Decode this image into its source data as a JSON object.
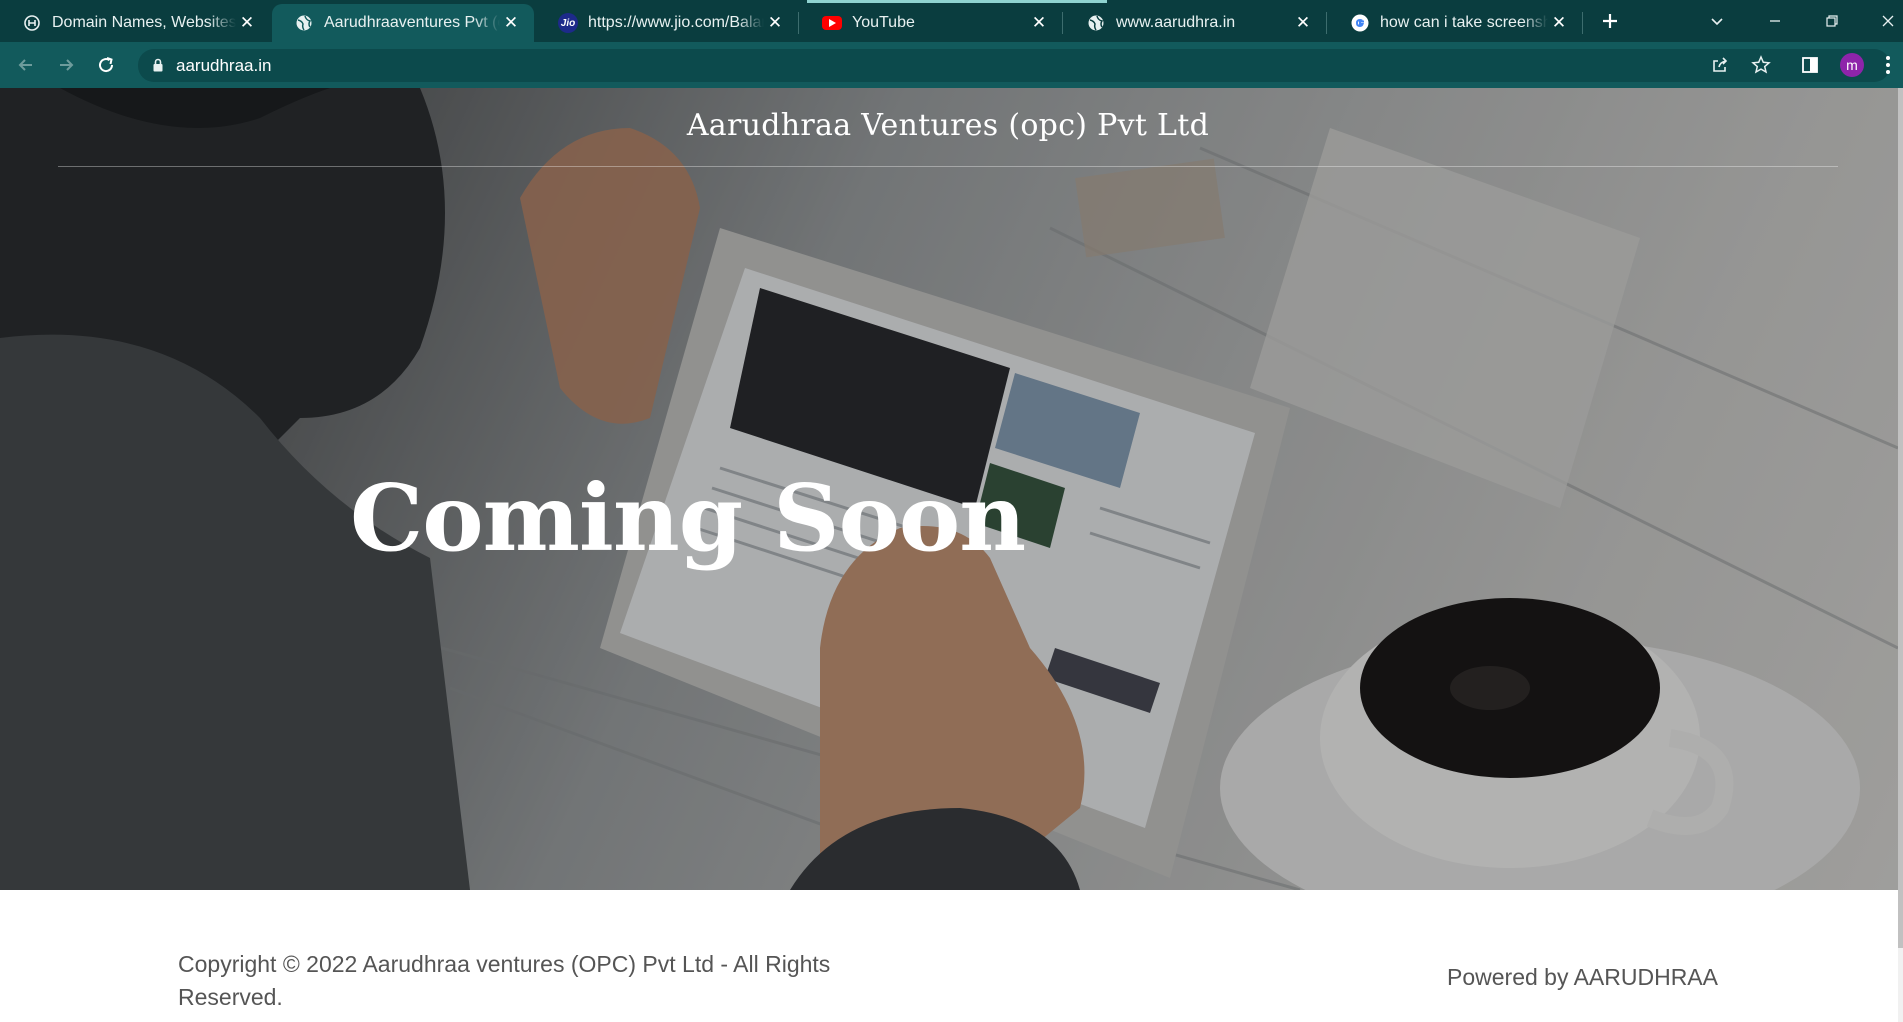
{
  "browser": {
    "tabs": [
      {
        "title": "Domain Names, Websites, H",
        "favicon": "hostinger-icon",
        "active": false
      },
      {
        "title": "Aarudhraaventures Pvt (opc",
        "favicon": "globe-icon",
        "active": true
      },
      {
        "title": "https://www.jio.com/Balanc",
        "favicon": "jio-icon",
        "active": false
      },
      {
        "title": "YouTube",
        "favicon": "youtube-icon",
        "active": false
      },
      {
        "title": "www.aarudhra.in",
        "favicon": "globe-icon",
        "active": false
      },
      {
        "title": "how can i take screenshot i",
        "favicon": "google-icon",
        "active": false
      }
    ],
    "jio_badge": "Jio",
    "new_tab_icon": "plus-icon",
    "address": "aarudhraa.in",
    "profile_initial": "m",
    "theme_color": "#0a3d3f",
    "toolbar_color": "#125a5c",
    "profile_color": "#8e24aa"
  },
  "site": {
    "title": "Aarudhraa Ventures (opc) Pvt Ltd",
    "headline": "Coming Soon",
    "hero_image": "person-using-tablet-with-coffee"
  },
  "footer": {
    "copyright": "Copyright © 2022 Aarudhraa ventures (OPC) Pvt  Ltd - All Rights Reserved.",
    "powered_by": "Powered by AARUDHRAA"
  }
}
